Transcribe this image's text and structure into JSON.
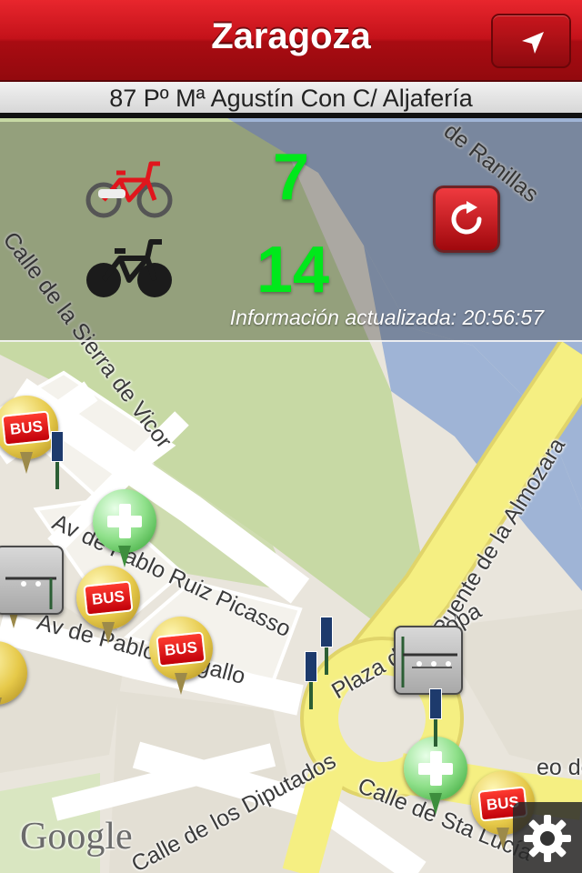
{
  "header": {
    "title": "Zaragoza",
    "station_name": "87 Pº Mª Agustín Con C/ Aljafería"
  },
  "station_info": {
    "available_bikes": "7",
    "free_slots": "14",
    "updated_text": "Información actualizada: 20:56:57"
  },
  "map": {
    "street_labels": [
      "Calle de la Sierra de Vicor",
      "Av de Pablo Ruiz Picasso",
      "Av de Pablo Gargallo",
      "Puente de la Almozara",
      "Plaza de Europa",
      "Calle de los Diputados",
      "Calle de Sta Lucía",
      "de Ranillas",
      "eo de"
    ],
    "bus_label": "BUS",
    "attribution": "Google"
  },
  "colors": {
    "brand_red": "#c4121a",
    "count_green": "#00e81b",
    "river_blue": "#9fb4d6",
    "main_road_yellow": "#f5ef82"
  },
  "icons": {
    "locate": "location-arrow-icon",
    "refresh": "refresh-icon",
    "settings": "gear-icon",
    "available_bike": "red-bike-icon",
    "free_slot": "black-bike-icon"
  }
}
